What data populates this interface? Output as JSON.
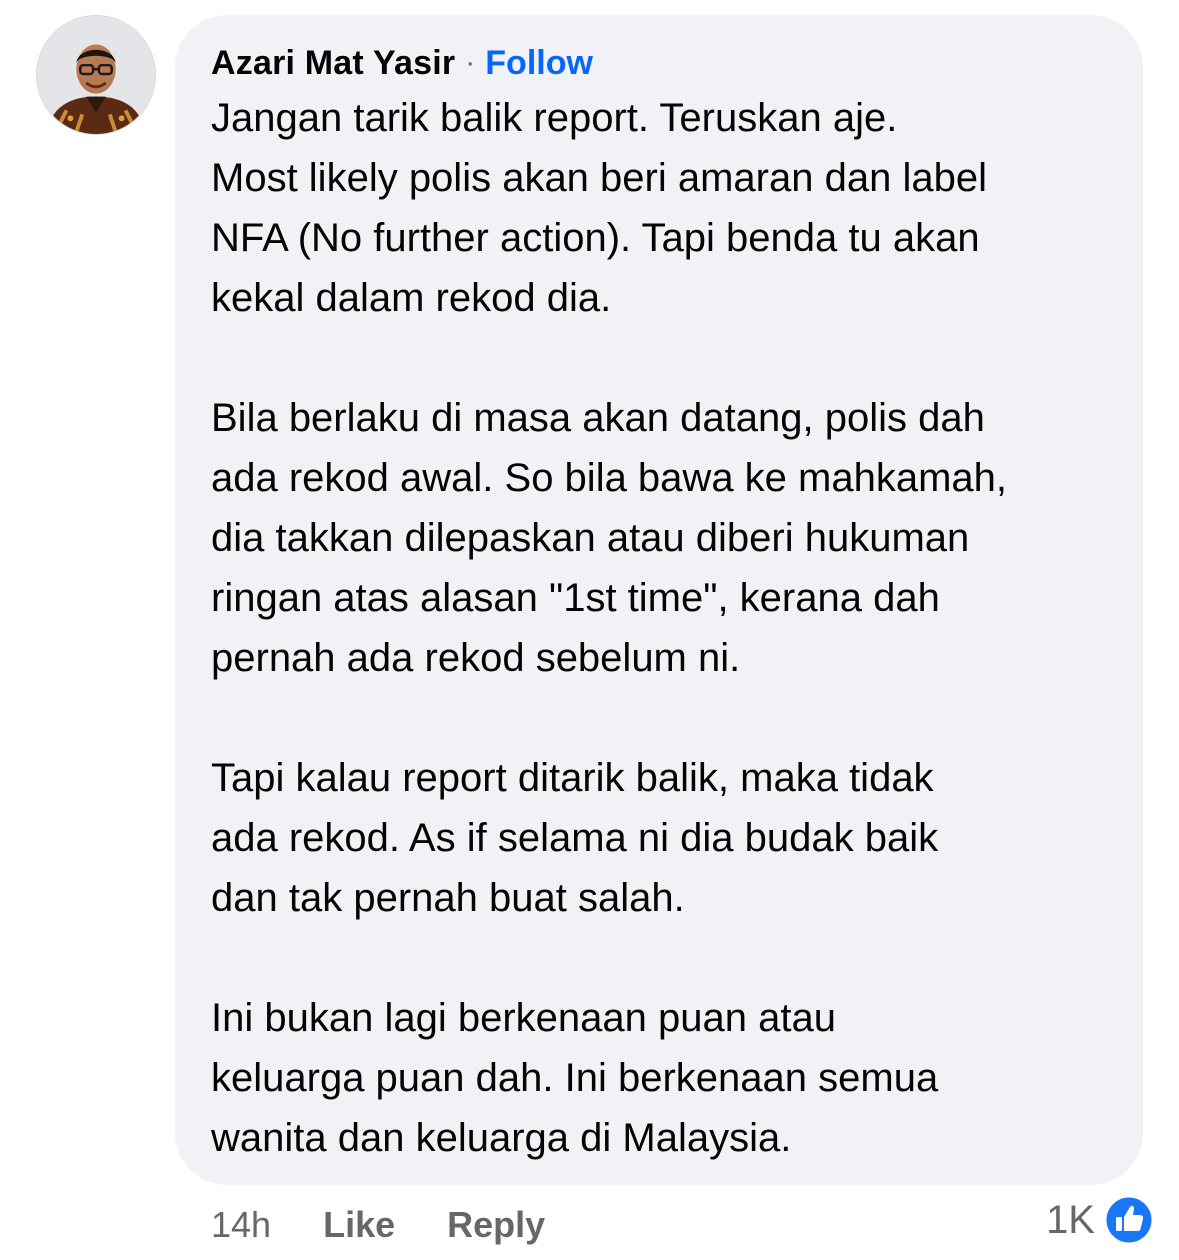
{
  "comment": {
    "author": "Azari Mat Yasir",
    "separator": "·",
    "follow_label": "Follow",
    "paragraphs": [
      "Jangan tarik balik report. Teruskan aje.\nMost likely polis akan beri amaran dan label\nNFA (No further action). Tapi benda tu akan\nkekal dalam rekod dia.",
      "Bila berlaku di masa akan datang, polis dah\nada rekod awal. So bila bawa ke mahkamah,\ndia takkan dilepaskan atau diberi hukuman\nringan atas alasan \"1st time\", kerana dah\npernah ada rekod sebelum ni.",
      "Tapi kalau report ditarik balik, maka tidak\nada rekod. As if selama ni dia budak baik\ndan tak pernah buat salah.",
      "Ini bukan lagi berkenaan puan atau\nkeluarga puan dah. Ini berkenaan semua\nwanita dan keluarga di Malaysia."
    ]
  },
  "actions": {
    "timestamp": "14h",
    "like_label": "Like",
    "reply_label": "Reply"
  },
  "reactions": {
    "count": "1K",
    "icon": "thumbs-up-icon"
  },
  "colors": {
    "bubble_background": "#f0f2f5",
    "link_blue": "#0866ff",
    "secondary_text": "#65676b"
  }
}
